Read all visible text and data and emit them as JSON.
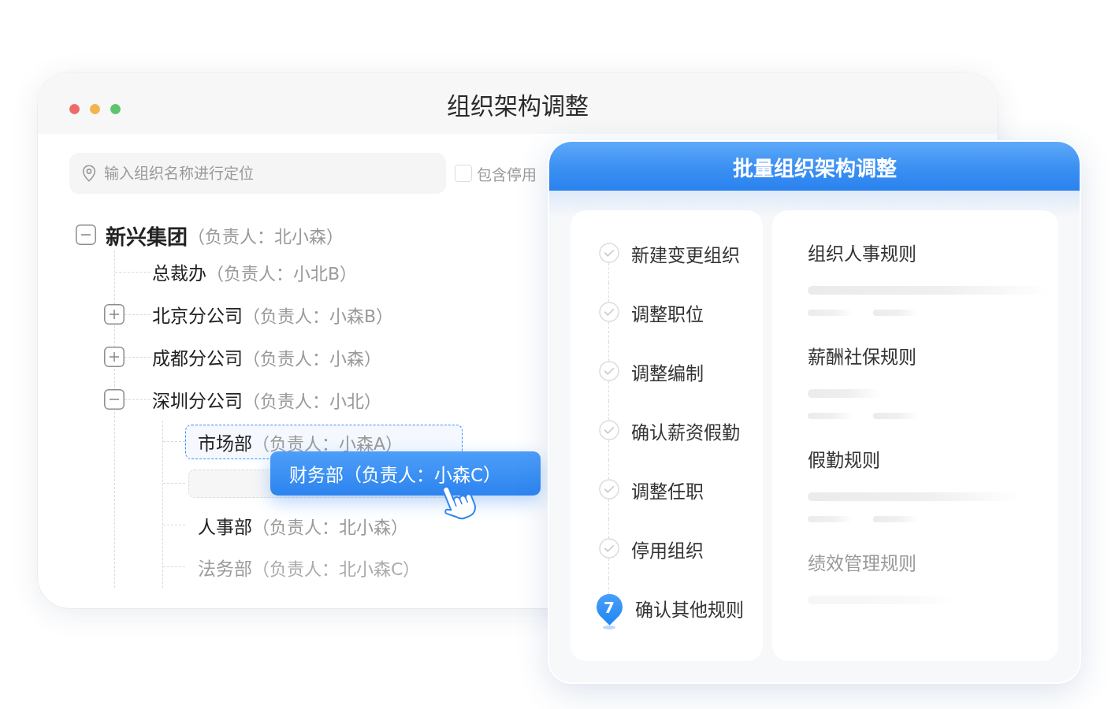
{
  "window": {
    "title": "组织架构调整"
  },
  "search": {
    "placeholder": "输入组织名称进行定位"
  },
  "include_disabled": {
    "label": "包含停用",
    "checked": false
  },
  "tree": [
    {
      "name": "新兴集团",
      "owner": "（负责人：北小森）",
      "expanded": true,
      "children": [
        {
          "name": "总裁办",
          "owner": "（负责人：小北B）"
        },
        {
          "name": "北京分公司",
          "owner": "（负责人：小森B）",
          "expanded": false
        },
        {
          "name": "成都分公司",
          "owner": "（负责人：小森）",
          "expanded": false
        },
        {
          "name": "深圳分公司",
          "owner": "（负责人：小北）",
          "expanded": true,
          "children": [
            {
              "kind": "node",
              "name": "市场部",
              "owner": "（负责人：小森A）",
              "highlighted": true,
              "faded": false
            },
            {
              "kind": "drop-slot"
            },
            {
              "kind": "node",
              "name": "人事部",
              "owner": "（负责人：北小森）",
              "highlighted": false,
              "faded": false
            },
            {
              "kind": "node",
              "name": "法务部",
              "owner": "（负责人：北小森C）",
              "highlighted": false,
              "faded": true
            }
          ]
        }
      ]
    }
  ],
  "drag_item": {
    "label": "财务部（负责人：小森C）"
  },
  "panel": {
    "title": "批量组织架构调整",
    "steps": [
      {
        "label": "新建变更组织",
        "completed": true
      },
      {
        "label": "调整职位",
        "completed": true
      },
      {
        "label": "调整编制",
        "completed": true
      },
      {
        "label": "确认薪资假勤",
        "completed": true
      },
      {
        "label": "调整任职",
        "completed": true
      },
      {
        "label": "停用组织",
        "completed": true
      },
      {
        "label": "确认其他规则",
        "completed": false,
        "number": "7"
      }
    ],
    "rules": [
      {
        "title": "组织人事规则",
        "dimmed": false
      },
      {
        "title": "薪酬社保规则",
        "dimmed": false
      },
      {
        "title": "假勤规则",
        "dimmed": false
      },
      {
        "title": "绩效管理规则",
        "dimmed": true
      }
    ]
  }
}
